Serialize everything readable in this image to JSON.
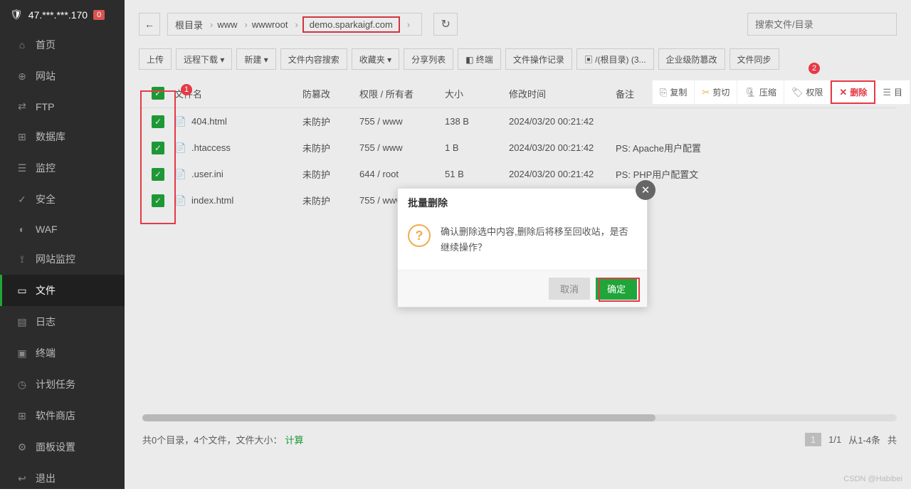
{
  "server_ip": "47.***.***.170",
  "server_badge": "0",
  "sidebar": [
    {
      "icon": "⌂",
      "label": "首页"
    },
    {
      "icon": "⊕",
      "label": "网站"
    },
    {
      "icon": "⇄",
      "label": "FTP"
    },
    {
      "icon": "⊞",
      "label": "数据库"
    },
    {
      "icon": "☰",
      "label": "监控"
    },
    {
      "icon": "✓",
      "label": "安全"
    },
    {
      "icon": "◐",
      "label": "WAF"
    },
    {
      "icon": "⟟",
      "label": "网站监控"
    },
    {
      "icon": "▭",
      "label": "文件",
      "active": true
    },
    {
      "icon": "▤",
      "label": "日志"
    },
    {
      "icon": "▣",
      "label": "终端"
    },
    {
      "icon": "◷",
      "label": "计划任务"
    },
    {
      "icon": "⊞",
      "label": "软件商店"
    },
    {
      "icon": "⚙",
      "label": "面板设置"
    },
    {
      "icon": "↩",
      "label": "退出"
    }
  ],
  "breadcrumb": [
    {
      "label": "根目录"
    },
    {
      "label": "www"
    },
    {
      "label": "wwwroot"
    },
    {
      "label": "demo.sparkaigf.com",
      "hl": true
    }
  ],
  "search_placeholder": "搜索文件/目录",
  "toolbar": [
    "上传",
    "远程下载 ▾",
    "新建 ▾",
    "文件内容搜索",
    "收藏夹 ▾",
    "分享列表",
    "◧ 终端",
    "文件操作记录",
    "▣ /(根目录) (3...",
    "企业级防篡改",
    "文件同步"
  ],
  "actions": [
    {
      "ic": "⎘",
      "label": "复制"
    },
    {
      "ic": "✂",
      "label": "剪切",
      "color": "#f0ad4e"
    },
    {
      "ic": "🗜",
      "label": "压缩"
    },
    {
      "ic": "🏷",
      "label": "权限"
    },
    {
      "ic": "✕",
      "label": "删除",
      "del": true
    },
    {
      "ic": "☰",
      "label": "目"
    }
  ],
  "columns": [
    "文件名",
    "防篡改",
    "权限 / 所有者",
    "大小",
    "修改时间",
    "备注"
  ],
  "files": [
    {
      "ic": "html",
      "name": "404.html",
      "tamper": "未防护",
      "perm": "755 / www",
      "size": "138 B",
      "mtime": "2024/03/20 00:21:42",
      "note": ""
    },
    {
      "ic": "file",
      "name": ".htaccess",
      "tamper": "未防护",
      "perm": "755 / www",
      "size": "1 B",
      "mtime": "2024/03/20 00:21:42",
      "note": "PS: Apache用户配置"
    },
    {
      "ic": "file",
      "name": ".user.ini",
      "tamper": "未防护",
      "perm": "644 / root",
      "size": "51 B",
      "mtime": "2024/03/20 00:21:42",
      "note": "PS: PHP用户配置文"
    },
    {
      "ic": "html",
      "name": "index.html",
      "tamper": "未防护",
      "perm": "755 / www",
      "size": "",
      "mtime": "",
      "note": ""
    }
  ],
  "footer": {
    "summary_prefix": "共0个目录，4个文件，文件大小：",
    "calc": "计算",
    "page_cur": "1",
    "page_total": "1/1",
    "range_prefix": "从1-4条",
    "range_suffix": "共"
  },
  "modal": {
    "title": "批量删除",
    "body": "确认删除选中内容,删除后将移至回收站，是否继续操作？",
    "cancel": "取消",
    "ok": "确定"
  },
  "watermark": "CSDN @Habibei"
}
